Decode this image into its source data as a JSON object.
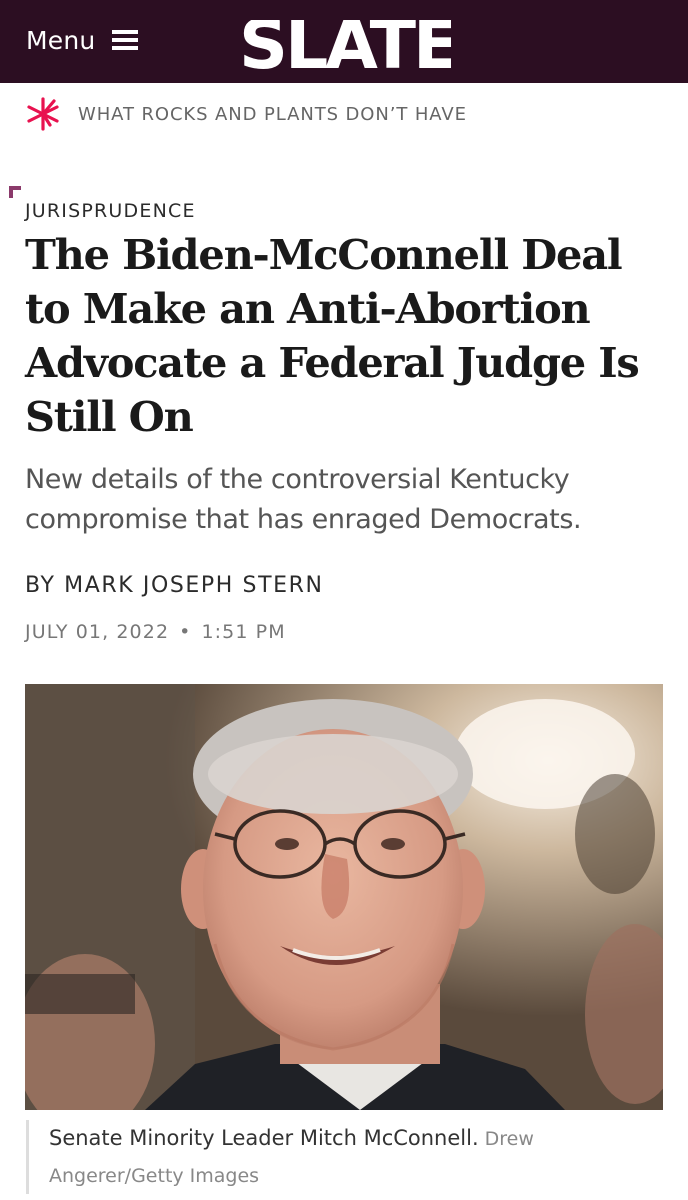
{
  "header": {
    "menu_label": "Menu",
    "menu_icon": "hamburger-icon",
    "logo_text": "SLATE",
    "background_color": "#2c0e22"
  },
  "tagline": {
    "icon": "slate-star-icon",
    "text": "WHAT ROCKS AND PLANTS DON’T HAVE",
    "icon_color": "#e8124f"
  },
  "article": {
    "section": "JURISPRUDENCE",
    "section_color": "#8b3a6b",
    "headline": "The Biden-McConnell Deal to Make an Anti-Abortion Advocate a Federal Judge Is Still On",
    "dek": "New details of the controversial Kentucky compromise that has enraged Democrats.",
    "byline_prefix": "BY",
    "author": "MARK JOSEPH STERN",
    "date": "JULY 01, 2022",
    "date_separator": "•",
    "time": "1:51 PM"
  },
  "photo": {
    "caption": "Senate Minority Leader Mitch McConnell.",
    "credit": "Drew Angerer/Getty Images"
  }
}
